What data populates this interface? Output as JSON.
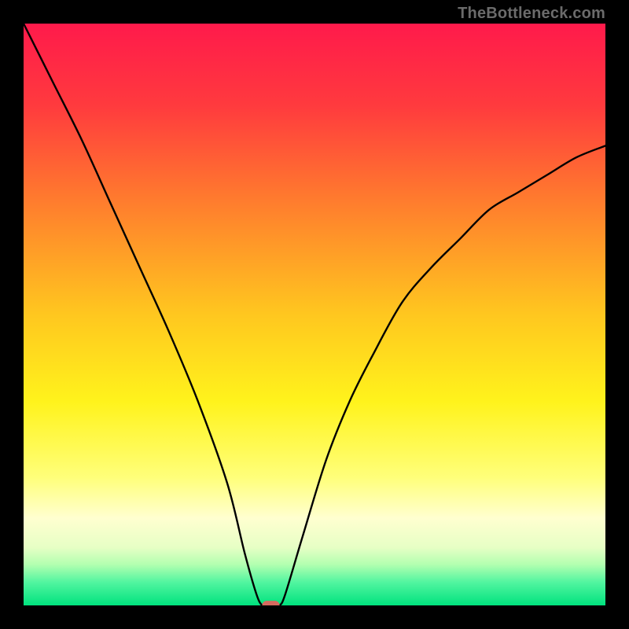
{
  "watermark": "TheBottleneck.com",
  "chart_data": {
    "type": "line",
    "title": "",
    "xlabel": "",
    "ylabel": "",
    "xlim": [
      0,
      100
    ],
    "ylim": [
      0,
      100
    ],
    "legend": false,
    "grid": false,
    "background_gradient": [
      {
        "offset": 0.0,
        "color": "#ff1a4b"
      },
      {
        "offset": 0.14,
        "color": "#ff3a3e"
      },
      {
        "offset": 0.3,
        "color": "#ff7a2e"
      },
      {
        "offset": 0.5,
        "color": "#ffc71f"
      },
      {
        "offset": 0.65,
        "color": "#fff31c"
      },
      {
        "offset": 0.78,
        "color": "#ffff7a"
      },
      {
        "offset": 0.85,
        "color": "#ffffd0"
      },
      {
        "offset": 0.9,
        "color": "#e7ffc5"
      },
      {
        "offset": 0.93,
        "color": "#b2ffb0"
      },
      {
        "offset": 0.96,
        "color": "#52f5a0"
      },
      {
        "offset": 1.0,
        "color": "#00e27e"
      }
    ],
    "series": [
      {
        "name": "bottleneck-curve",
        "color": "#000000",
        "x": [
          0,
          5,
          10,
          15,
          20,
          25,
          30,
          35,
          38,
          40,
          41,
          42,
          43,
          44,
          45,
          48,
          52,
          56,
          60,
          65,
          70,
          75,
          80,
          85,
          90,
          95,
          100
        ],
        "y": [
          100,
          90,
          80,
          69,
          58,
          47,
          35,
          21,
          9,
          2,
          0,
          0,
          0,
          0,
          2,
          12,
          25,
          35,
          43,
          52,
          58,
          63,
          68,
          71,
          74,
          77,
          79
        ]
      }
    ],
    "marker": {
      "name": "optimal-point",
      "x": 42.5,
      "y": 0,
      "color": "#d66a5f",
      "shape": "rounded-rect",
      "width": 3.0,
      "height": 1.6
    }
  }
}
